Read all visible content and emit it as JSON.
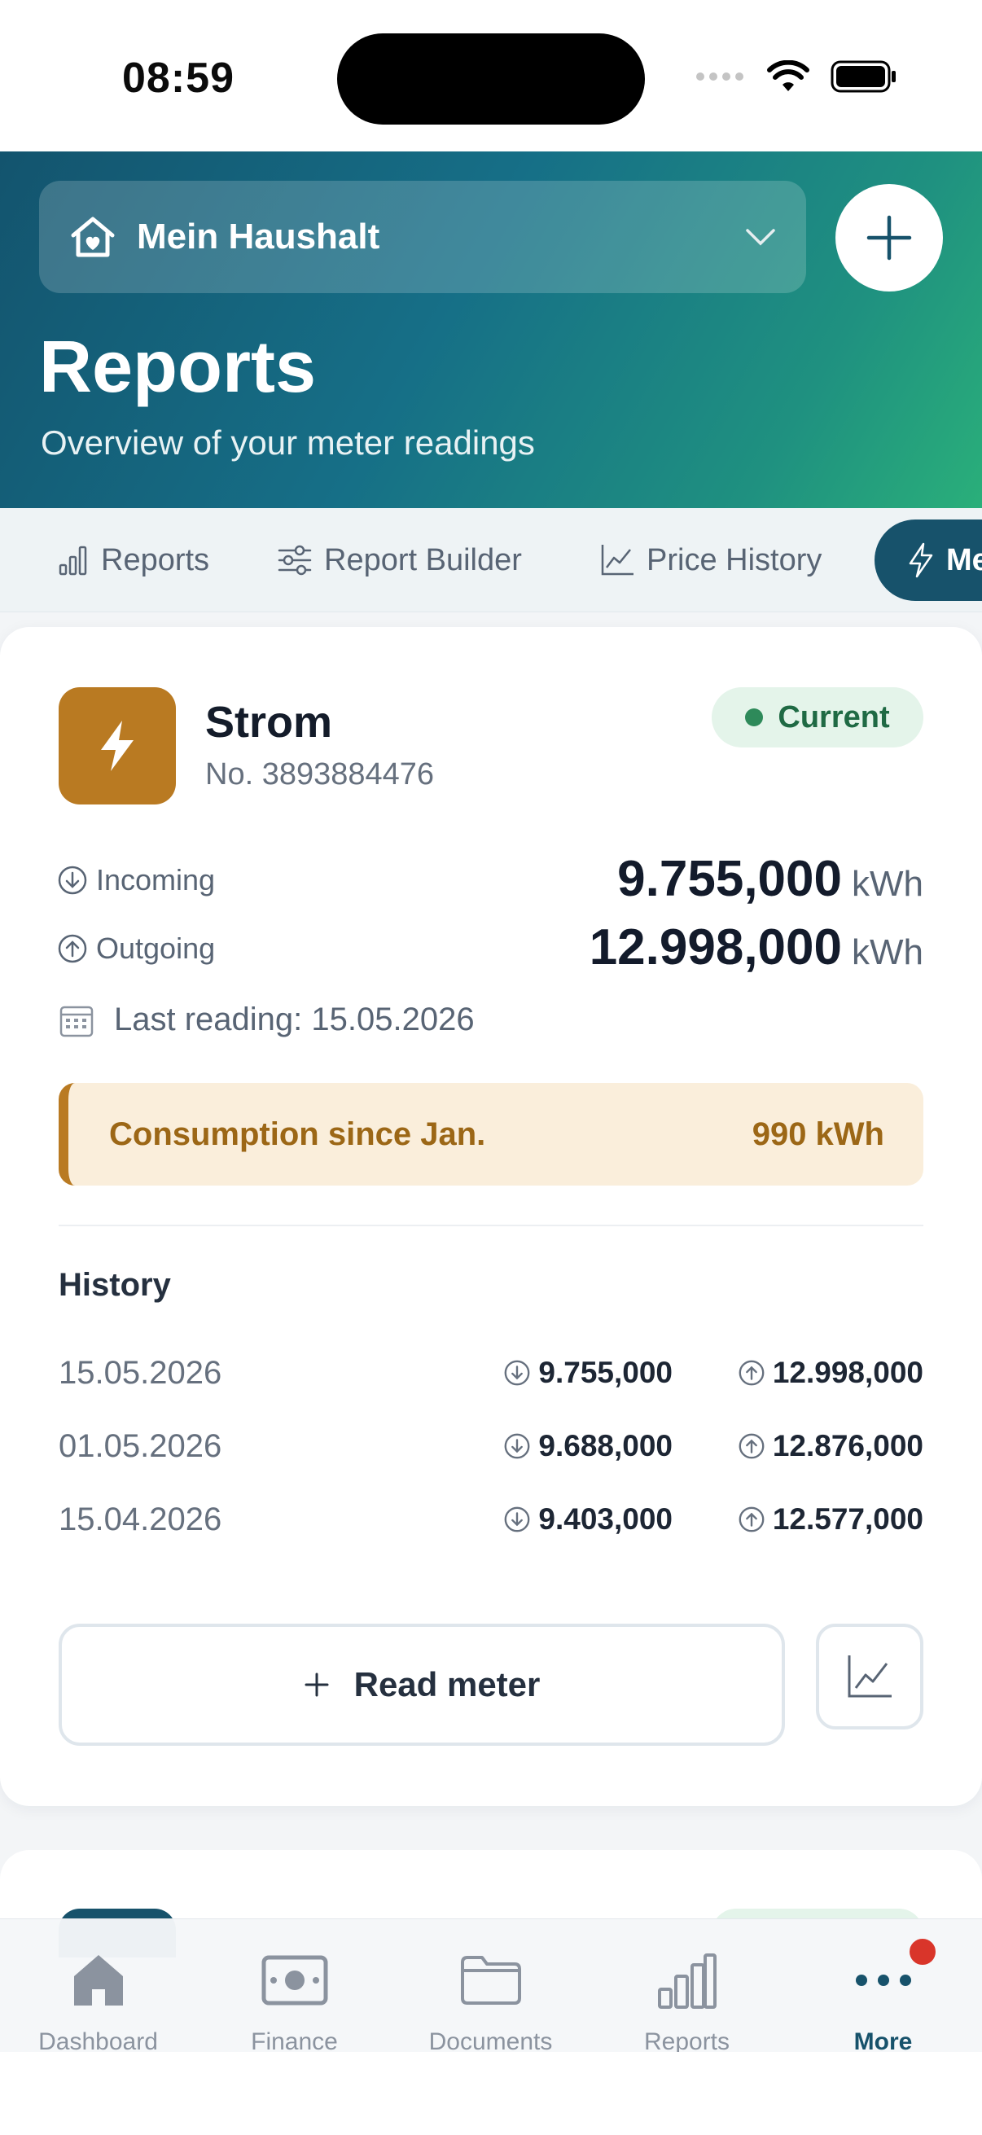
{
  "status_bar": {
    "time": "08:59"
  },
  "header": {
    "household": "Mein Haushalt",
    "title": "Reports",
    "subtitle": "Overview of your meter readings"
  },
  "tabs": [
    {
      "label": "Reports",
      "icon": "bar-chart-icon"
    },
    {
      "label": "Report Builder",
      "icon": "sliders-icon"
    },
    {
      "label": "Price History",
      "icon": "trend-chart-icon"
    },
    {
      "label": "Me",
      "icon": "lightning-icon",
      "active": true
    }
  ],
  "meter": {
    "name": "Strom",
    "number": "No. 3893884476",
    "status": "Current",
    "incoming_label": "Incoming",
    "incoming_value": "9.755,000",
    "outgoing_label": "Outgoing",
    "outgoing_value": "12.998,000",
    "unit": "kWh",
    "last_reading": "Last reading: 15.05.2026",
    "consumption_label": "Consumption since Jan.",
    "consumption_value": "990 kWh",
    "history_title": "History",
    "history": [
      {
        "date": "15.05.2026",
        "in": "9.755,000",
        "out": "12.998,000"
      },
      {
        "date": "01.05.2026",
        "in": "9.688,000",
        "out": "12.876,000"
      },
      {
        "date": "15.04.2026",
        "in": "9.403,000",
        "out": "12.577,000"
      }
    ],
    "read_button": "Read meter"
  },
  "bottom_nav": [
    {
      "label": "Dashboard",
      "icon": "home-icon"
    },
    {
      "label": "Finance",
      "icon": "money-icon"
    },
    {
      "label": "Documents",
      "icon": "folder-icon"
    },
    {
      "label": "Reports",
      "icon": "bar-chart-icon"
    },
    {
      "label": "More",
      "icon": "more-icon",
      "active": true
    }
  ],
  "colors": {
    "primary": "#17526b",
    "accent_orange": "#b97a22",
    "success": "#2e8a5a",
    "notification": "#d9352a"
  }
}
